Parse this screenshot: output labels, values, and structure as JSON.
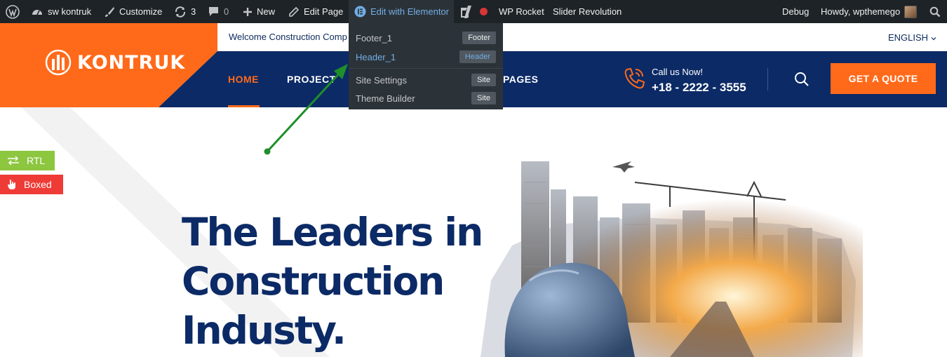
{
  "adminbar": {
    "site_name": "sw kontruk",
    "customize": "Customize",
    "updates_count": "3",
    "comments_count": "0",
    "new": "New",
    "edit_page": "Edit Page",
    "edit_with_elementor": "Edit with Elementor",
    "wp_rocket": "WP Rocket",
    "slider_revolution": "Slider Revolution",
    "debug": "Debug",
    "howdy": "Howdy, wpthemego"
  },
  "elementor_menu": {
    "items": [
      {
        "label": "Footer_1",
        "badge": "Footer"
      },
      {
        "label": "Header_1",
        "badge": "Header"
      },
      {
        "label": "Site Settings",
        "badge": "Site"
      },
      {
        "label": "Theme Builder",
        "badge": "Site"
      }
    ]
  },
  "header": {
    "logo_text": "KONTRUK",
    "welcome": "Welcome Construction Comp",
    "language": "ENGLISH",
    "nav": [
      "HOME",
      "PROJECT",
      "PAGES"
    ],
    "call_label": "Call us Now!",
    "call_number": "+18 - 2222 - 3555",
    "quote_button": "GET A QUOTE"
  },
  "side_toggles": {
    "rtl": "RTL",
    "boxed": "Boxed"
  },
  "hero": {
    "title_lines": [
      "The Leaders in",
      "Construction",
      "Industy."
    ]
  },
  "colors": {
    "admin_bar": "#1d2327",
    "brand_orange": "#ff6a1a",
    "nav_blue": "#0b2a66",
    "rtl_green": "#8dc63f",
    "boxed_red": "#ef3b36",
    "arrow_green": "#1f8f2a"
  }
}
